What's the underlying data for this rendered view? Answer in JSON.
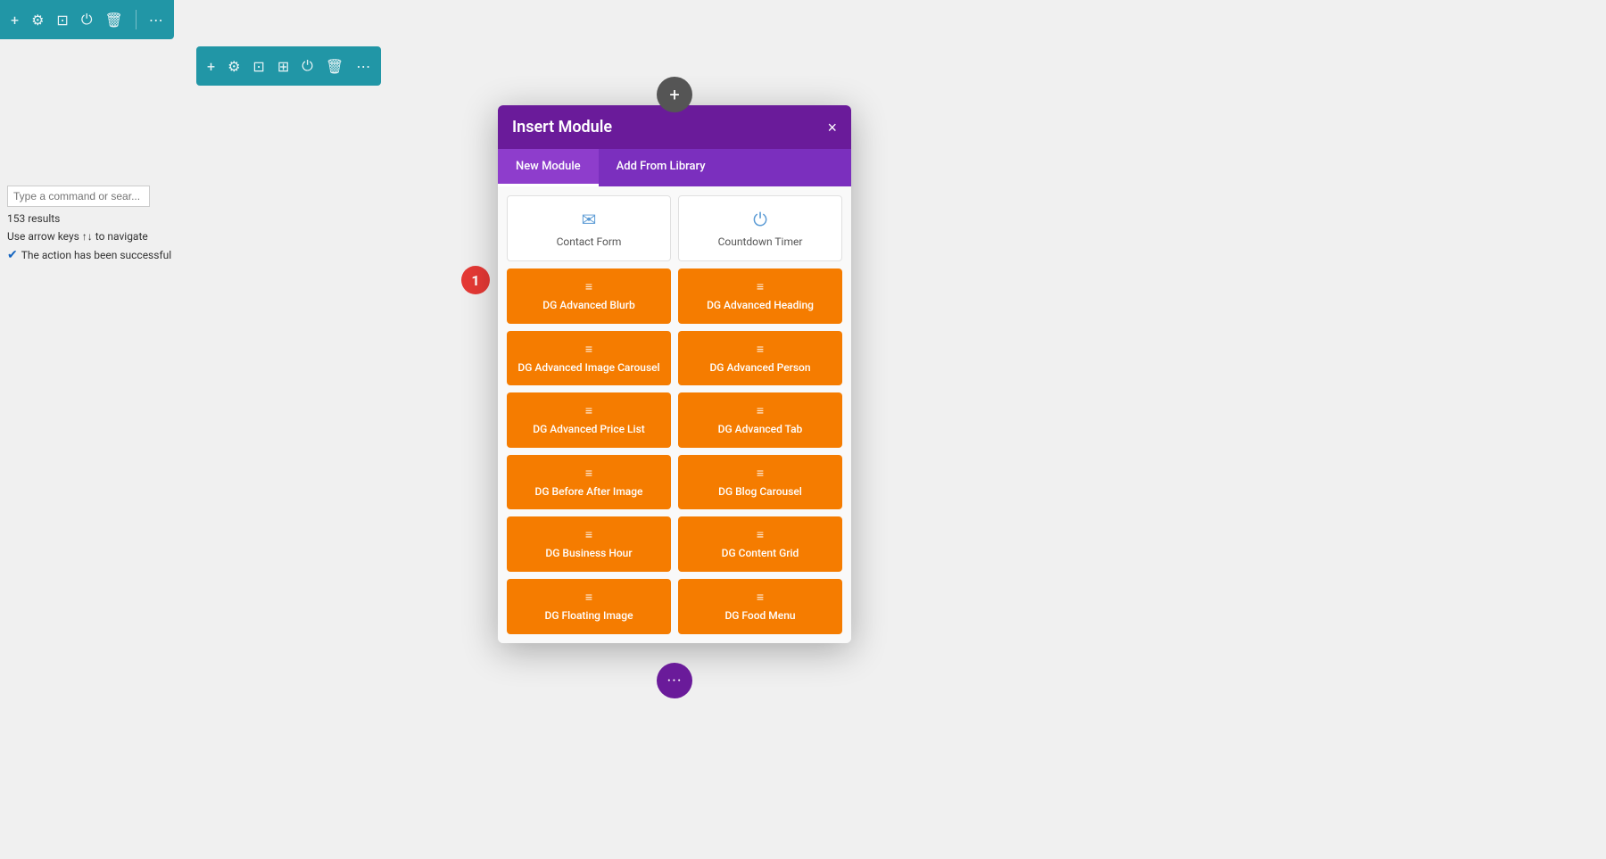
{
  "topToolbar": {
    "icons": [
      "plus",
      "gear",
      "layout",
      "power",
      "trash",
      "dots"
    ]
  },
  "secondToolbar": {
    "icons": [
      "plus",
      "gear",
      "layout",
      "grid",
      "power",
      "trash",
      "dots"
    ]
  },
  "leftPanel": {
    "searchPlaceholder": "Type a command or sear...",
    "resultsText": "153 results",
    "navHint": "Use arrow keys ↑↓ to navigate",
    "successMessage": "The action has been successful"
  },
  "stepBadge": "1",
  "addButtonTop": "+",
  "dotsButtonBottom": "···",
  "modal": {
    "title": "Insert Module",
    "closeLabel": "×",
    "tabs": [
      {
        "label": "New Module",
        "active": true
      },
      {
        "label": "Add From Library",
        "active": false
      }
    ],
    "whiteModules": [
      {
        "label": "Contact Form",
        "icon": "envelope"
      },
      {
        "label": "Countdown Timer",
        "icon": "power"
      }
    ],
    "orangeModules": [
      {
        "label": "DG Advanced Blurb",
        "icon": "≡"
      },
      {
        "label": "DG Advanced Heading",
        "icon": "≡"
      },
      {
        "label": "DG Advanced Image Carousel",
        "icon": "≡"
      },
      {
        "label": "DG Advanced Person",
        "icon": "≡"
      },
      {
        "label": "DG Advanced Price List",
        "icon": "≡"
      },
      {
        "label": "DG Advanced Tab",
        "icon": "≡"
      },
      {
        "label": "DG Before After Image",
        "icon": "≡"
      },
      {
        "label": "DG Blog Carousel",
        "icon": "≡"
      },
      {
        "label": "DG Business Hour",
        "icon": "≡"
      },
      {
        "label": "DG Content Grid",
        "icon": "≡"
      },
      {
        "label": "DG Floating Image",
        "icon": "≡"
      },
      {
        "label": "DG Food Menu",
        "icon": "≡"
      }
    ]
  }
}
